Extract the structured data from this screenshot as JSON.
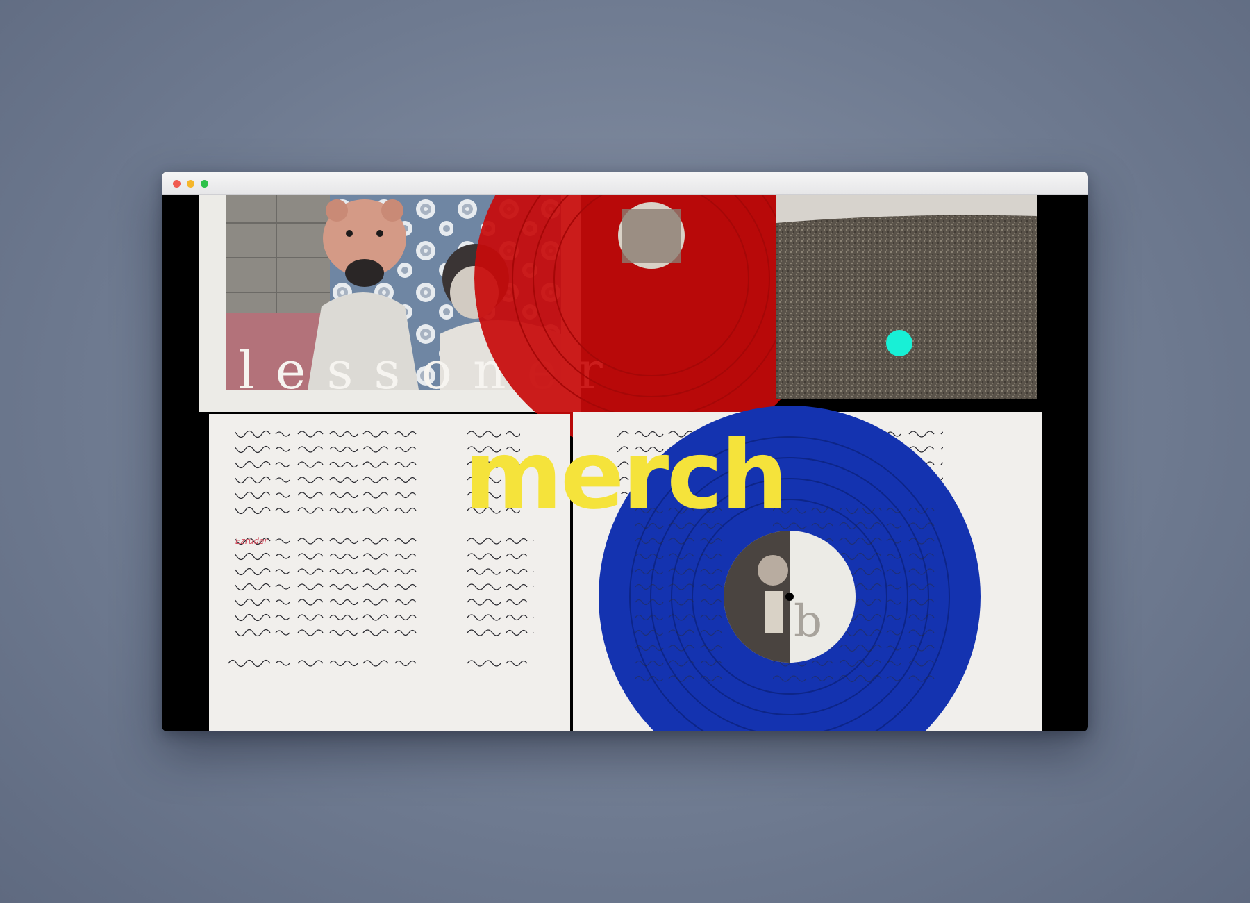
{
  "window": {
    "controls": [
      "close",
      "minimize",
      "zoom"
    ],
    "background": "#000000"
  },
  "hero": {
    "image_description_icon": "vinyl-record-gatefold-photo",
    "cover_lettering": "lessoner",
    "label_letter": "b",
    "title": "merch",
    "title_color": "#f5e33b",
    "cursor_color": "#18f0d6"
  },
  "colors": {
    "red_vinyl": "#c80a0a",
    "blue_vinyl": "#1433b0",
    "paper": "#f1efec"
  }
}
